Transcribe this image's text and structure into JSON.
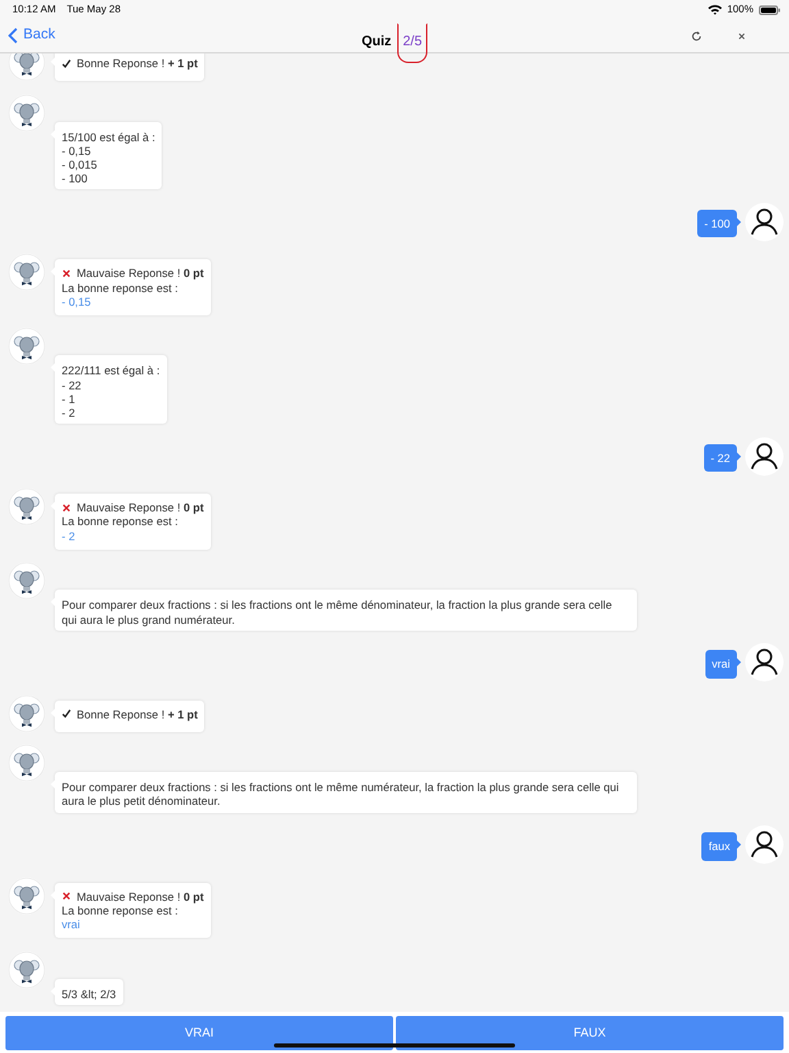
{
  "status_bar": {
    "time": "10:12 AM",
    "date": "Tue May 28",
    "battery": "100%"
  },
  "nav": {
    "back": "Back",
    "title": "Quiz",
    "progress": "2/5",
    "highlighted": true
  },
  "messages": [
    {
      "kind": "feedback",
      "correct": true,
      "text": "Bonne Reponse ! **+ 1 pt**"
    },
    {
      "kind": "question",
      "lines": [
        "15/100 est égal à :",
        "- 0,15",
        "- 0,015",
        "- 100"
      ]
    },
    {
      "kind": "answer",
      "text": "- 100"
    },
    {
      "kind": "feedback",
      "correct": false,
      "text": "Mauvaise Reponse ! **0 pt**",
      "label": "La bonne reponse est :",
      "answer": "- 0,15"
    },
    {
      "kind": "question",
      "lines": [
        "222/111 est égal à :",
        "- 22",
        "- 1",
        "- 2"
      ]
    },
    {
      "kind": "answer",
      "text": "- 22"
    },
    {
      "kind": "feedback",
      "correct": false,
      "text": "Mauvaise Reponse ! **0 pt**",
      "label": "La bonne reponse est :",
      "answer": "- 2"
    },
    {
      "kind": "question",
      "lines": [
        "Pour comparer deux fractions : si les fractions ont le même dénominateur, la fraction la plus grande sera celle qui aura le plus grand numérateur."
      ]
    },
    {
      "kind": "answer",
      "text": "vrai"
    },
    {
      "kind": "feedback",
      "correct": true,
      "text": "Bonne Reponse ! **+ 1 pt**"
    },
    {
      "kind": "question",
      "lines": [
        "Pour comparer deux fractions : si les fractions ont le même numérateur, la fraction la plus grande sera celle qui aura le plus petit dénominateur."
      ]
    },
    {
      "kind": "answer",
      "text": "faux"
    },
    {
      "kind": "feedback",
      "correct": false,
      "text": "Mauvaise Reponse ! **0 pt**",
      "label": "La bonne reponse est :",
      "answer": "vrai"
    },
    {
      "kind": "question",
      "lines": [
        "5/3 &lt; 2/3"
      ]
    }
  ],
  "buttons": [
    "VRAI",
    "FAUX"
  ]
}
